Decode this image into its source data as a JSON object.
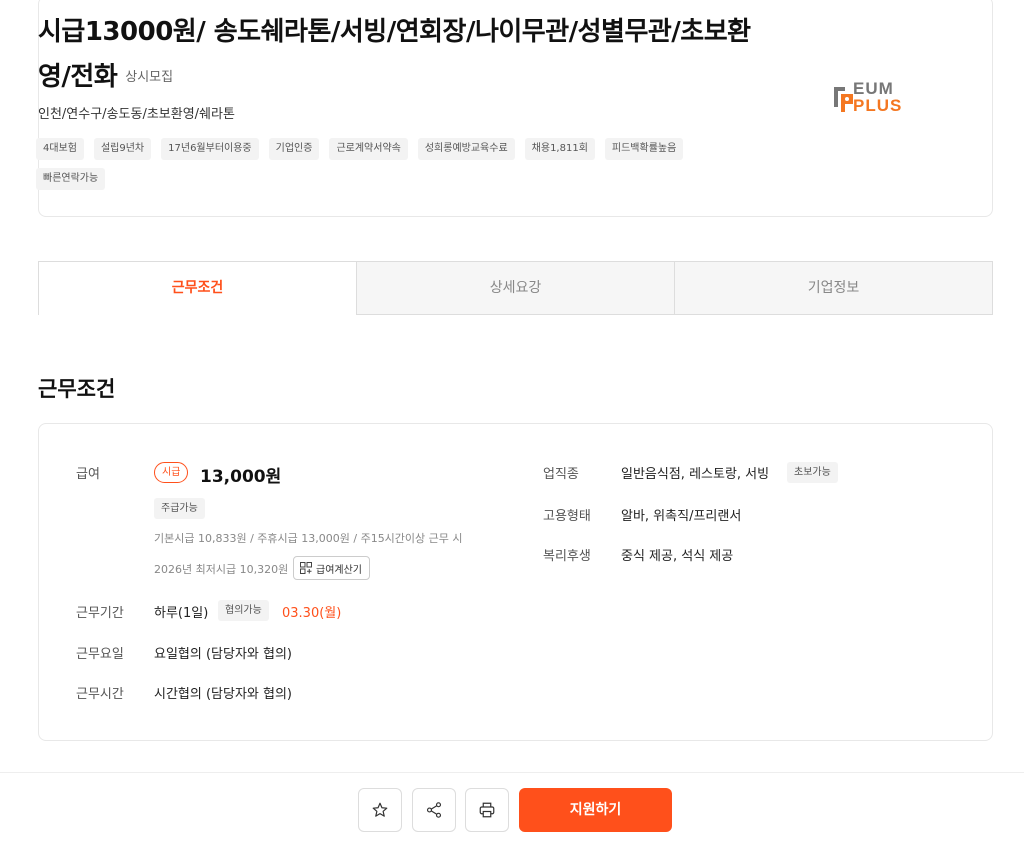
{
  "job": {
    "title": "시급13000원/ 송도쉐라톤/서빙/연회장/나이무관/성별무관/초보환영/전화",
    "recruit_type": "상시모집",
    "location": "인천/연수구/송도동/초보환영/쉐라톤",
    "tags": [
      "4대보험",
      "설립9년차",
      "17년6월부터이용중",
      "기업인증",
      "근로계약서약속",
      "성희롱예방교육수료",
      "채용1,811회",
      "피드백확률높음",
      "빠른연락가능"
    ],
    "logo": {
      "line1": "EUM",
      "line2": "PLUS",
      "brand_color": "#f47721"
    }
  },
  "tabs": [
    {
      "label": "근무조건",
      "active": true
    },
    {
      "label": "상세요강",
      "active": false
    },
    {
      "label": "기업정보",
      "active": false
    }
  ],
  "conditions": {
    "section_title": "근무조건",
    "wage_label": "급여",
    "wage_type": "시급",
    "wage_amount": "13,000원",
    "weekly_pay": "주급가능",
    "wage_note": "기본시급 10,833원 / 주휴시급 13,000원 / 주15시간이상 근무 시",
    "min_wage_note": "2026년 최저시급 10,320원",
    "calc_button": "급여계산기",
    "period_label": "근무기간",
    "period_value": "하루(1일)",
    "period_badge": "협의가능",
    "period_date": "03.30(월)",
    "days_label": "근무요일",
    "days_value": "요일협의 (담당자와 협의)",
    "time_label": "근무시간",
    "time_value": "시간협의 (담당자와 협의)",
    "industry_label": "업직종",
    "industry_value": "일반음식점, 레스토랑, 서빙",
    "industry_badge": "초보가능",
    "employment_label": "고용형태",
    "employment_value": "알바, 위촉직/프리랜서",
    "benefits_label": "복리후생",
    "benefits_value": "중식 제공, 석식 제공"
  },
  "actions": {
    "apply_label": "지원하기",
    "icons": [
      "star-icon",
      "share-icon",
      "print-icon"
    ]
  },
  "colors": {
    "accent": "#ff501b"
  }
}
